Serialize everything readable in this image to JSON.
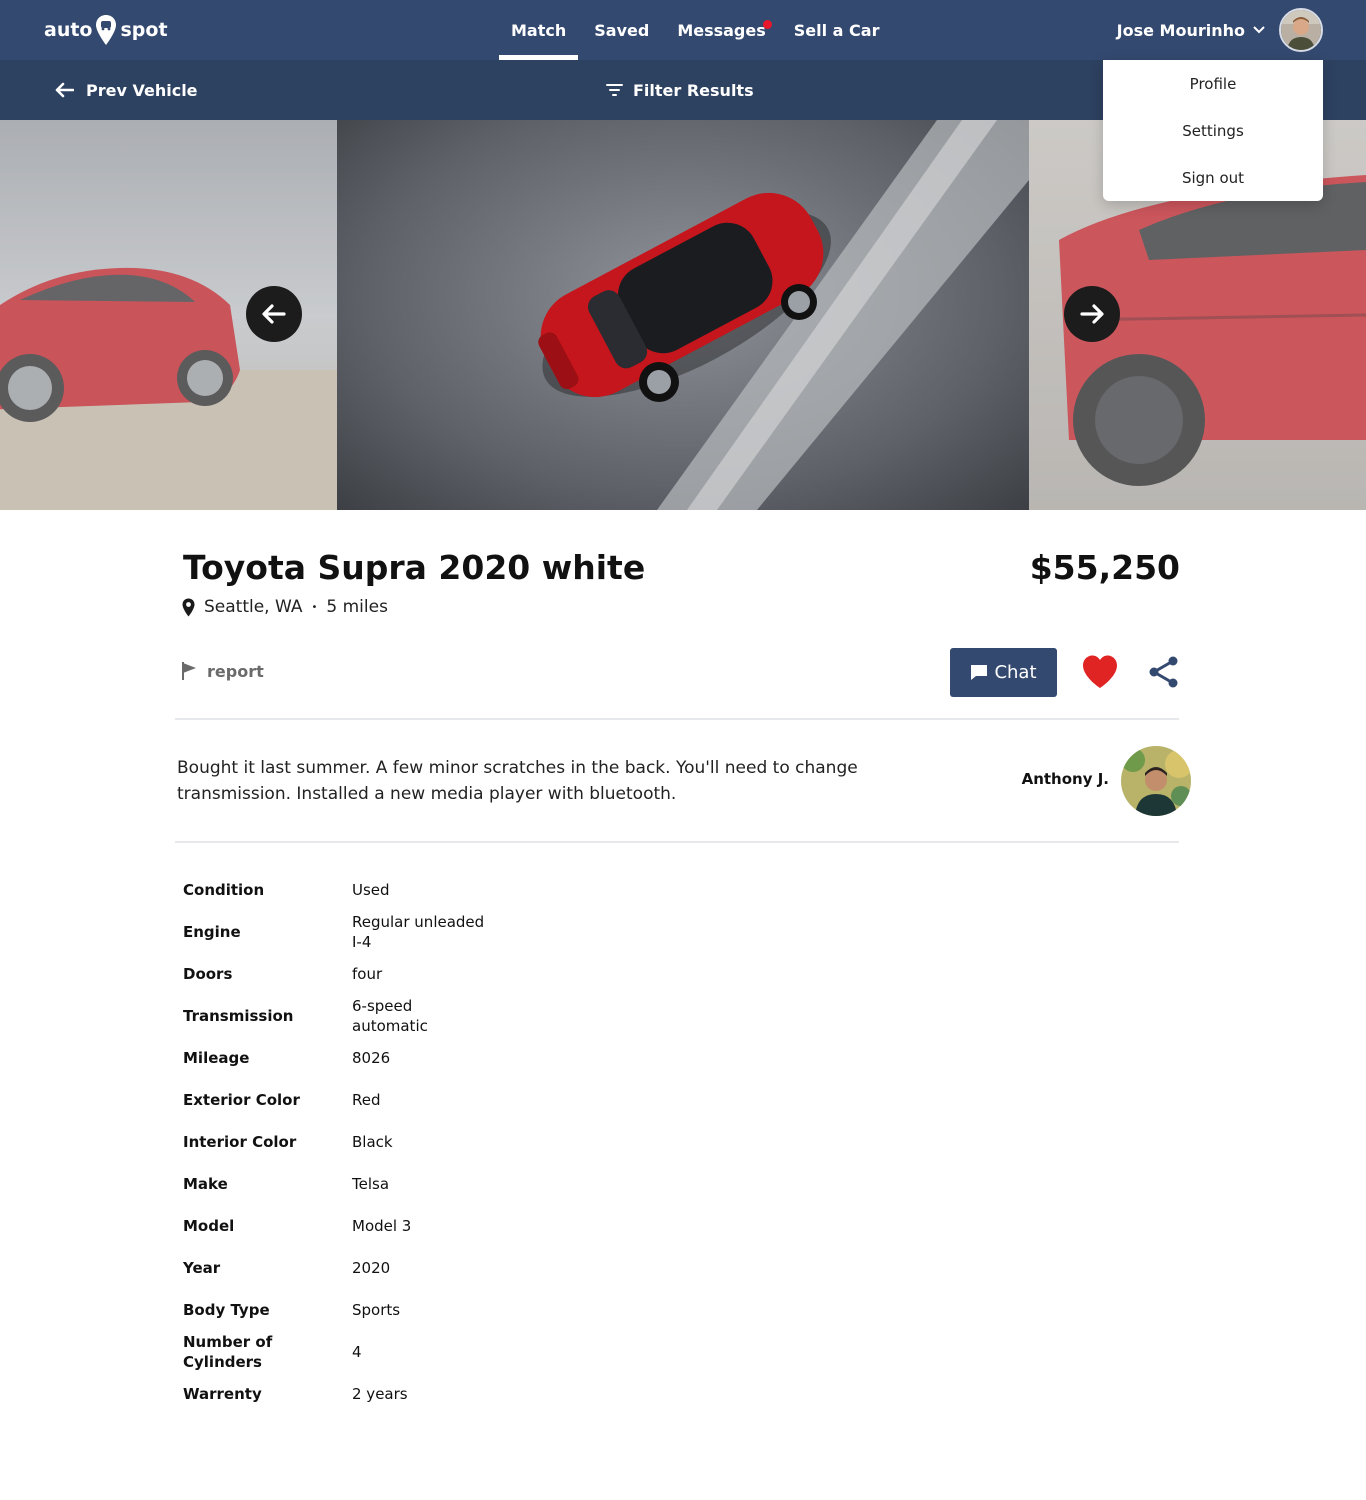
{
  "nav": {
    "logo_left": "auto",
    "logo_right": "spot",
    "links": [
      {
        "label": "Match"
      },
      {
        "label": "Saved"
      },
      {
        "label": "Messages"
      },
      {
        "label": "Sell a Car"
      }
    ],
    "active": "Match",
    "user_name": "Jose Mourinho"
  },
  "subnav": {
    "prev_label": "Prev Vehicle",
    "filter_label": "Filter Results"
  },
  "user_menu": {
    "items": [
      {
        "label": "Profile"
      },
      {
        "label": "Settings"
      },
      {
        "label": "Sign out"
      }
    ]
  },
  "listing": {
    "title": "Toyota Supra 2020 white",
    "price": "$55,250",
    "location": "Seattle, WA",
    "separator": "•",
    "distance": "5 miles",
    "report_label": "report",
    "chat_label": "Chat",
    "description": "Bought it last summer. A few minor scratches in the back. You'll need to change transmission. Installed a new media player with bluetooth.",
    "seller_name": "Anthony J.",
    "favorited": true
  },
  "specs": [
    {
      "label": "Condition",
      "value": "Used"
    },
    {
      "label": "Engine",
      "value": "Regular unleaded\nI-4"
    },
    {
      "label": "Doors",
      "value": "four"
    },
    {
      "label": "Transmission",
      "value": "6-speed\nautomatic"
    },
    {
      "label": "Mileage",
      "value": "8026"
    },
    {
      "label": "Exterior Color",
      "value": "Red"
    },
    {
      "label": "Interior Color",
      "value": "Black"
    },
    {
      "label": "Make",
      "value": "Telsa"
    },
    {
      "label": "Model",
      "value": "Model 3"
    },
    {
      "label": "Year",
      "value": "2020"
    },
    {
      "label": "Body Type",
      "value": "Sports"
    },
    {
      "label": "Number of\nCylinders",
      "value": "4"
    },
    {
      "label": "Warrenty",
      "value": "2 years"
    }
  ],
  "colors": {
    "nav_bg": "#34496f",
    "subnav_bg": "#2d4160",
    "accent": "#34496f",
    "notification": "#e8182c",
    "heart": "#e02424",
    "car_red": "#c4161c"
  },
  "icons": [
    "pin-logo-icon",
    "chevron-down-icon",
    "arrow-left-icon",
    "filter-icon",
    "arrow-right-icon",
    "location-pin-icon",
    "flag-icon",
    "chat-bubble-icon",
    "heart-icon",
    "share-icon"
  ]
}
